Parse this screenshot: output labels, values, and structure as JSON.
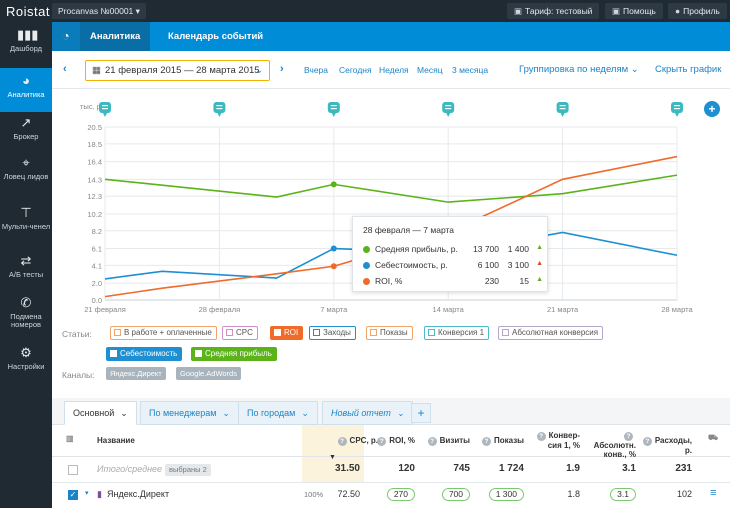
{
  "app": {
    "logo": "Roistat",
    "project": "Procanvas №00001 ▾",
    "tariff": "Тариф: тестовый",
    "help": "Помощь",
    "profile": "Профиль"
  },
  "sidebar": {
    "items": [
      {
        "label": "Дашборд",
        "icon": "bar-chart-icon"
      },
      {
        "label": "Аналитика",
        "icon": "pie-chart-icon"
      },
      {
        "label": "Брокер",
        "icon": "trend-line-icon"
      },
      {
        "label": "Ловец лидов",
        "icon": "crosshair-icon"
      },
      {
        "label": "Мульти-ченел",
        "icon": "hierarchy-icon"
      },
      {
        "label": "А/Б тесты",
        "icon": "shuffle-icon"
      },
      {
        "label": "Подмена номеров",
        "icon": "phone-icon"
      },
      {
        "label": "Настройки",
        "icon": "gear-icon"
      }
    ]
  },
  "subnav": {
    "tabs": [
      "Аналитика",
      "Календарь событий"
    ]
  },
  "daterow": {
    "range": "21 февраля 2015 — 28 марта 2015",
    "quick": [
      "Вчера",
      "Сегодня",
      "Неделя",
      "Месяц",
      "3 месяца"
    ],
    "grouping": "Группировка по неделям",
    "hide_chart": "Скрыть график"
  },
  "chart_data": {
    "type": "line",
    "ylabel": "тыс. р.",
    "yticks": [
      "20.5",
      "18.5",
      "16.4",
      "14.3",
      "12.3",
      "10.2",
      "8.2",
      "6.1",
      "4.1",
      "2.0",
      "0.0"
    ],
    "ylim": [
      0,
      20.5
    ],
    "categories": [
      "21 февраля",
      "28 февраля",
      "7 марта",
      "14 марта",
      "21 марта",
      "28 марта"
    ],
    "series": [
      {
        "name": "Средняя прибыль, р.",
        "color": "#5bb319",
        "values": [
          14.3,
          13.6,
          12.2,
          13.7,
          11.6,
          12.6,
          14.8
        ]
      },
      {
        "name": "Себестоимость, р.",
        "color": "#1e8fd1",
        "values": [
          2.5,
          3.4,
          2.6,
          6.1,
          5.6,
          8.0,
          5.3
        ]
      },
      {
        "name": "ROI, %",
        "color": "#f06a2a",
        "values": [
          0.4,
          1.4,
          3.1,
          4.0,
          8.0,
          14.3,
          17.0
        ]
      }
    ],
    "x_positions": [
      0,
      0.5,
      1.5,
      2,
      3,
      4,
      5
    ],
    "grid": true
  },
  "tooltip": {
    "title": "28 февраля — 7 марта",
    "rows": [
      {
        "label": "Средняя прибыль, р.",
        "v1": "13 700",
        "v2": "1 400",
        "color": "#5bb319",
        "arrow": "▲",
        "arrow_color": "#5bb319"
      },
      {
        "label": "Себестоимость, р.",
        "v1": "6 100",
        "v2": "3 100",
        "color": "#1e8fd1",
        "arrow": "▲",
        "arrow_color": "#e04b2a"
      },
      {
        "label": "ROI, %",
        "v1": "230",
        "v2": "15",
        "color": "#f06a2a",
        "arrow": "▲",
        "arrow_color": "#5bb319"
      }
    ]
  },
  "filters": {
    "stats_label": "Статьи:",
    "chips": [
      {
        "label": "В работе + оплаченные",
        "color": "#f0a56b",
        "filled": false
      },
      {
        "label": "CPC",
        "color": "#d38fc8",
        "filled": false
      },
      {
        "label": "ROI",
        "color": "#f06a2a",
        "filled": true
      },
      {
        "label": "Заходы",
        "color": "#1e8fd1",
        "filled": false
      },
      {
        "label": "Показы",
        "color": "#f0a56b",
        "filled": false
      },
      {
        "label": "Конверсия 1",
        "color": "#4fb9c9",
        "filled": false
      },
      {
        "label": "Абсолютная конверсия",
        "color": "#b4a7c9",
        "filled": false
      },
      {
        "label": "Себестоимость",
        "color": "#1e8fd1",
        "filled": true
      },
      {
        "label": "Средняя прибыль",
        "color": "#5bb319",
        "filled": true
      }
    ],
    "channels_label": "Каналы:",
    "channels": [
      "Яндекс.Директ",
      "Google.AdWords"
    ]
  },
  "report_tabs": {
    "tabs": [
      "Основной",
      "По менеджерам",
      "По городам",
      "Новый отчет"
    ],
    "add": "+"
  },
  "table": {
    "headers": {
      "name": "Название",
      "cpc": "CPC, р.",
      "roi": "ROI, %",
      "visits": "Визиты",
      "shows": "Показы",
      "conv1": [
        "Конвер-",
        "сия 1, %"
      ],
      "abs": [
        "Абсолютн.",
        "конв., %"
      ],
      "spend": "Расходы, р."
    },
    "totals": {
      "label": "Итого/среднее",
      "selected": "выбраны 2",
      "cpc": "31.50",
      "roi": "120",
      "visits": "745",
      "shows": "1 724",
      "conv1": "1.9",
      "abs": "3.1",
      "spend": "231"
    },
    "rows": [
      {
        "name": "Яндекс.Директ",
        "pct": "100%",
        "cpc": "72.50",
        "roi": "270",
        "visits": "700",
        "shows": "1 300",
        "conv1": "1.8",
        "abs": "3.1",
        "spend": "102"
      }
    ]
  }
}
